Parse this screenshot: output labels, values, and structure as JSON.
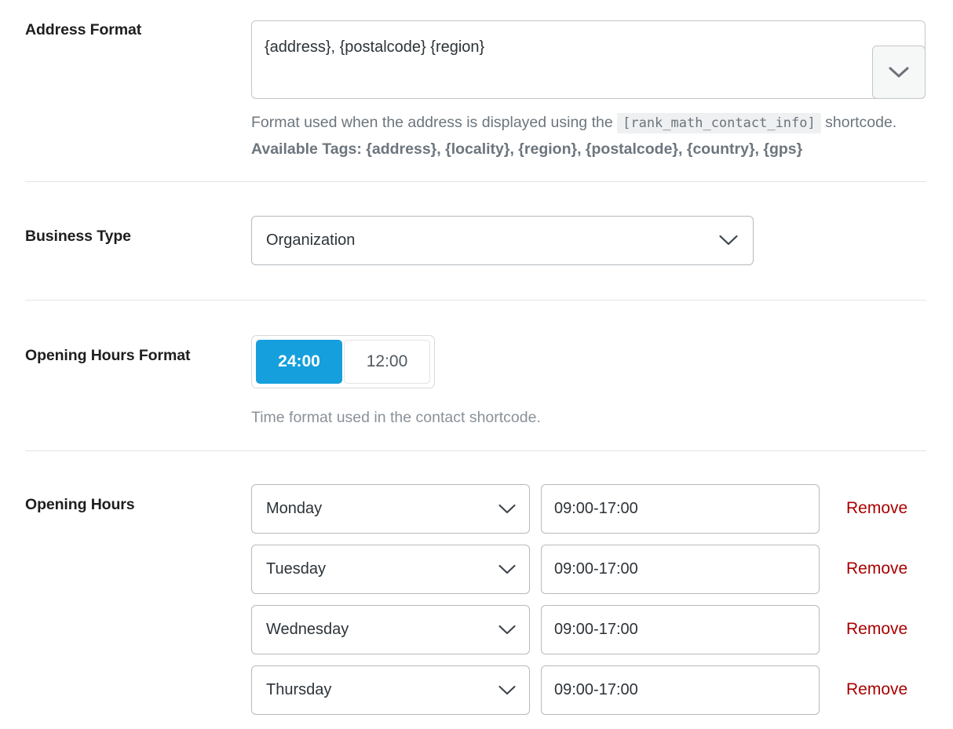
{
  "address_format": {
    "label": "Address Format",
    "value": "{address}, {postalcode} {region}",
    "dropdown_icon": "chevron-down-icon",
    "help_prefix": "Format used when the address is displayed using the",
    "help_shortcode": "[rank_math_contact_info]",
    "help_suffix": "shortcode.",
    "available_tags": "Available Tags: {address}, {locality}, {region}, {postalcode}, {country}, {gps}"
  },
  "business_type": {
    "label": "Business Type",
    "value": "Organization",
    "chevron_icon": "chevron-down-icon"
  },
  "opening_hours_format": {
    "label": "Opening Hours Format",
    "options": [
      {
        "label": "24:00",
        "active": true
      },
      {
        "label": "12:00",
        "active": false
      }
    ],
    "help": "Time format used in the contact shortcode.",
    "active_color": "#159fdd"
  },
  "opening_hours": {
    "label": "Opening Hours",
    "remove_label": "Remove",
    "remove_color": "#a80000",
    "rows": [
      {
        "day": "Monday",
        "time": "09:00-17:00"
      },
      {
        "day": "Tuesday",
        "time": "09:00-17:00"
      },
      {
        "day": "Wednesday",
        "time": "09:00-17:00"
      },
      {
        "day": "Thursday",
        "time": "09:00-17:00"
      }
    ]
  }
}
